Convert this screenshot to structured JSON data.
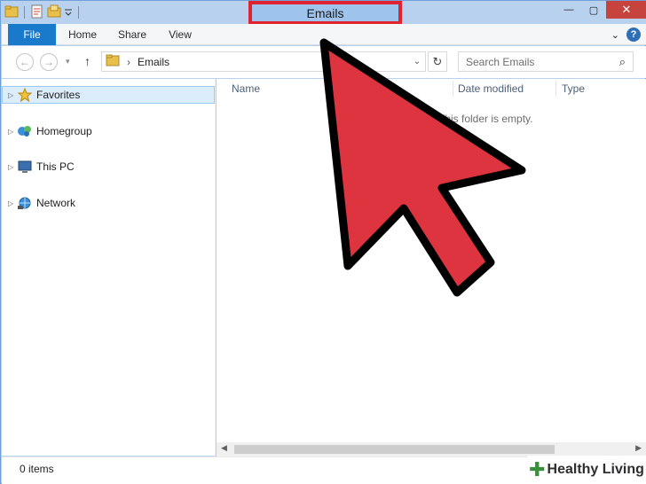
{
  "window": {
    "title": "Emails",
    "minimize_glyph": "—",
    "maximize_glyph": "▢",
    "close_glyph": "✕"
  },
  "ribbon": {
    "tabs": [
      "File",
      "Home",
      "Share",
      "View"
    ],
    "collapse_glyph": "⌄",
    "help_glyph": "?"
  },
  "navigation": {
    "back_glyph": "←",
    "forward_glyph": "→",
    "recent_glyph": "▾",
    "up_glyph": "↑",
    "path_separator": "›",
    "current_folder": "Emails",
    "dropdown_glyph": "⌄",
    "refresh_glyph": "↻",
    "search_placeholder": "Search Emails",
    "search_glyph": "⌕"
  },
  "nav_pane": {
    "items": [
      {
        "label": "Favorites",
        "icon": "star-icon",
        "selected": true
      },
      {
        "label": "Homegroup",
        "icon": "homegroup-icon",
        "selected": false
      },
      {
        "label": "This PC",
        "icon": "computer-icon",
        "selected": false
      },
      {
        "label": "Network",
        "icon": "network-icon",
        "selected": false
      }
    ],
    "expand_glyph": "▷"
  },
  "file_list": {
    "columns": [
      "Name",
      "Date modified",
      "Type"
    ],
    "empty_message": "This folder is empty."
  },
  "status_bar": {
    "item_count": "0 items"
  },
  "watermark": {
    "text": "Healthy Living"
  },
  "colors": {
    "highlight_box": "#e0242f",
    "arrow_fill": "#dd3440",
    "file_tab": "#1979ca",
    "selection": "#dbecfa"
  }
}
